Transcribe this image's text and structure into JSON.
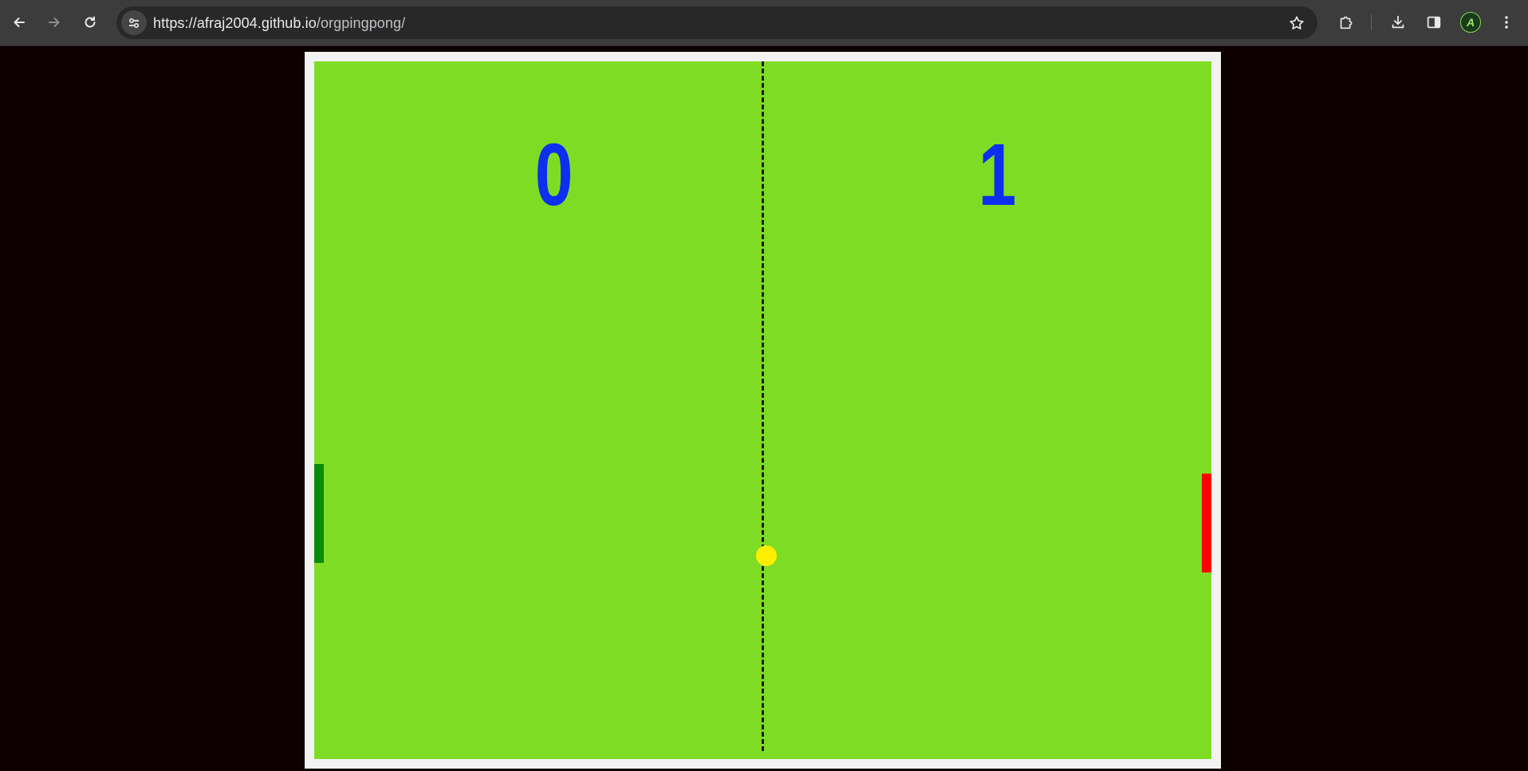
{
  "browser": {
    "url_host": "https://afraj2004.github.io",
    "url_path": "/orgpingpong/",
    "profile_initial": "A",
    "icons": {
      "back": "arrow-left-icon",
      "forward": "arrow-right-icon",
      "reload": "reload-icon",
      "site_info": "tune-icon",
      "bookmark": "star-icon",
      "extensions": "puzzle-icon",
      "downloads": "download-icon",
      "side_panel": "side-panel-icon",
      "menu": "kebab-menu-icon"
    }
  },
  "game": {
    "score_left": "0",
    "score_right": "1",
    "colors": {
      "field": "#7fdc24",
      "frame": "#f2f2f2",
      "score": "#0d2ff0",
      "left_paddle": "#0a8a0a",
      "right_paddle": "#ff0000",
      "ball": "#ffee00",
      "net": "#1a1a1a"
    }
  }
}
